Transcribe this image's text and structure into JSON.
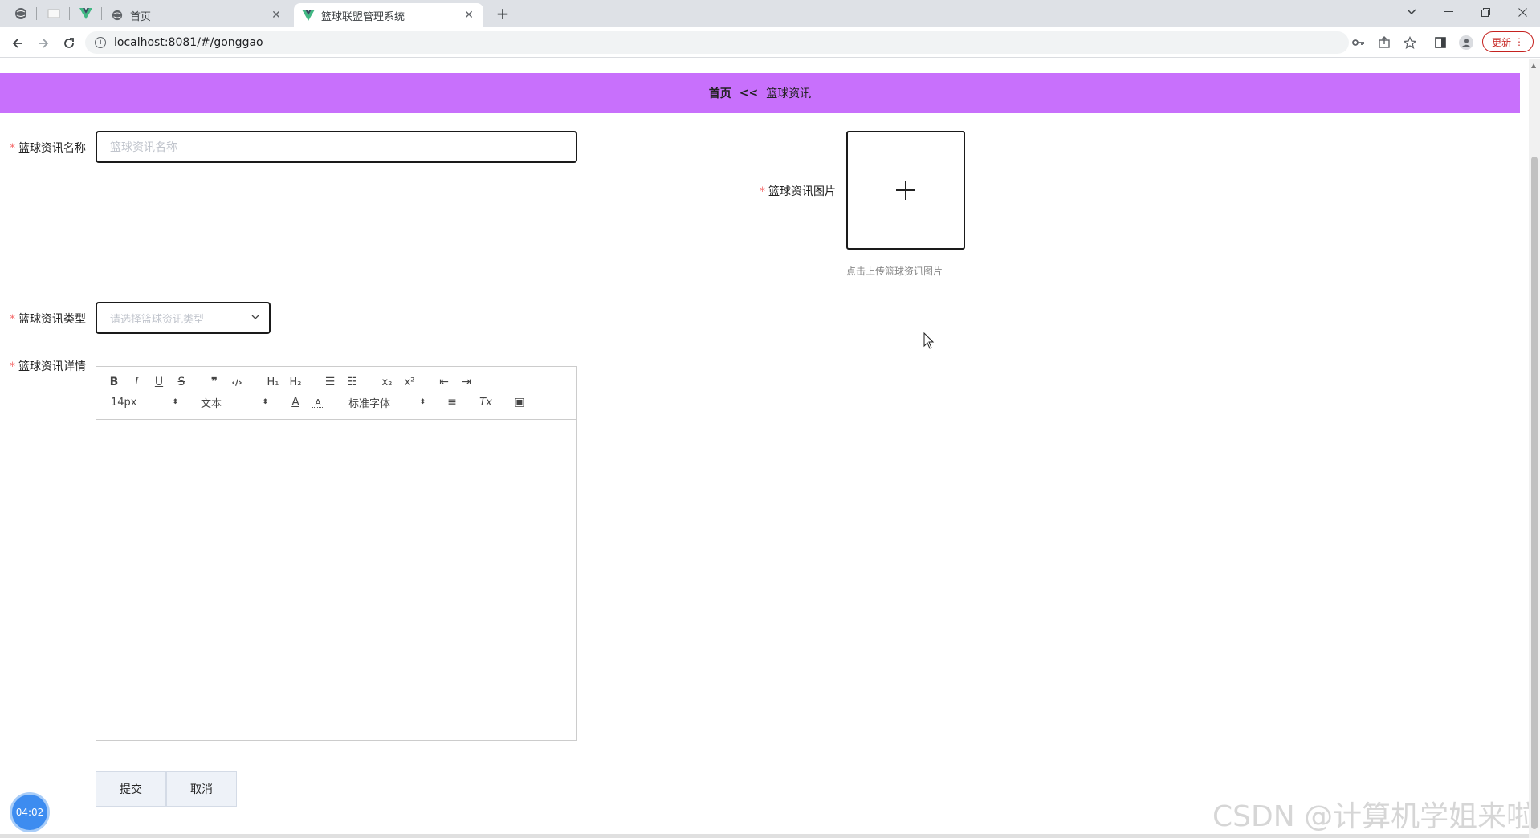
{
  "browser": {
    "tabs": [
      {
        "title": "首页",
        "icon": "globe-icon",
        "active": false
      },
      {
        "title": "篮球联盟管理系统",
        "icon": "vue-logo-icon",
        "active": true
      }
    ],
    "url": "localhost:8081/#/gonggao",
    "update_label": "更新"
  },
  "breadcrumb": {
    "home": "首页",
    "separator": "<<",
    "current": "篮球资讯"
  },
  "form": {
    "required_mark": "*",
    "name": {
      "label": "篮球资讯名称",
      "placeholder": "篮球资讯名称"
    },
    "image": {
      "label": "篮球资讯图片",
      "tip": "点击上传篮球资讯图片"
    },
    "type": {
      "label": "篮球资讯类型",
      "placeholder": "请选择篮球资讯类型"
    },
    "detail": {
      "label": "篮球资讯详情",
      "toolbar": {
        "bold": "B",
        "italic": "I",
        "underline": "U",
        "strike": "S",
        "quote": "❞",
        "code": "‹/›",
        "h1": "H₁",
        "h2": "H₂",
        "ordered_list": "☰",
        "bullet_list": "☷",
        "subscript": "x₂",
        "superscript": "x²",
        "indent_decrease": "⇤",
        "indent_increase": "⇥",
        "size": "14px",
        "header": "文本",
        "color": "A",
        "background": "A",
        "font": "标准字体",
        "align": "≡",
        "clean": "Tx",
        "image": "▣"
      }
    },
    "submit_label": "提交",
    "cancel_label": "取消"
  },
  "timer": "04:02",
  "watermark": "CSDN @计算机学姐来啦",
  "colors": {
    "breadcrumb_bg": "#c870fc",
    "required": "#f56c6c",
    "timer": "#3d8cf0"
  }
}
